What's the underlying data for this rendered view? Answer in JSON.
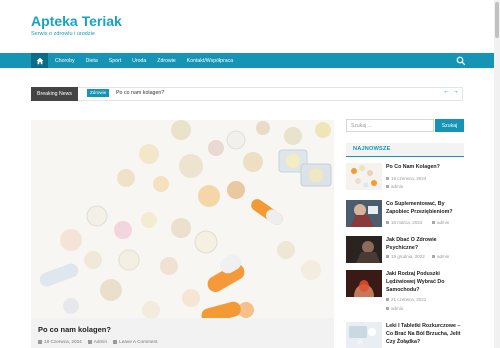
{
  "site": {
    "title": "Apteka Teriak",
    "description": "Serwis o zdrowiu i urodzie"
  },
  "nav": {
    "home_icon": "home-icon",
    "items": [
      "Choroby",
      "Dieta",
      "Sport",
      "Uroda",
      "Zdrowie",
      "Kontakt/Współpraca"
    ],
    "search_icon": "search-icon"
  },
  "breaking": {
    "label": "Breaking News",
    "category": "Zdrowie",
    "title": "Po co nam kolagen?",
    "prev": "←",
    "next": "→"
  },
  "featured": {
    "title": "Po co nam kolagen?",
    "date": "18 Czerwca, 2024",
    "author": "Admin",
    "comment": "Leave A Comment"
  },
  "sidebar": {
    "search_placeholder": "Szukaj ...",
    "search_button": "Szukaj",
    "heading": "NAJNOWSZE",
    "posts": [
      {
        "title": "Po Co Nam Kolagen?",
        "date": "18 czerwca, 2024",
        "author": "admin"
      },
      {
        "title": "Co Suplementować, By Zapobiec Przeziębieniom?",
        "date": "16 marca, 2023",
        "author": "admin"
      },
      {
        "title": "Jak Dbać O Zdrowie Psychiczne?",
        "date": "19 grudnia, 2022",
        "author": "admin"
      },
      {
        "title": "Jaki Rodzaj Poduszki Lędźwiowej Wybrać Do Samochodu?",
        "date": "21 czerwca, 2021",
        "author": "admin"
      },
      {
        "title": "Leki I Tabletki Rozkurczowe – Co Brać Na Ból Brzucha, Jelit Czy Żołądka?",
        "date": "",
        "author": ""
      }
    ]
  },
  "colors": {
    "accent": "#1594b5",
    "title": "#17a3c4",
    "dark_label": "#444444"
  }
}
